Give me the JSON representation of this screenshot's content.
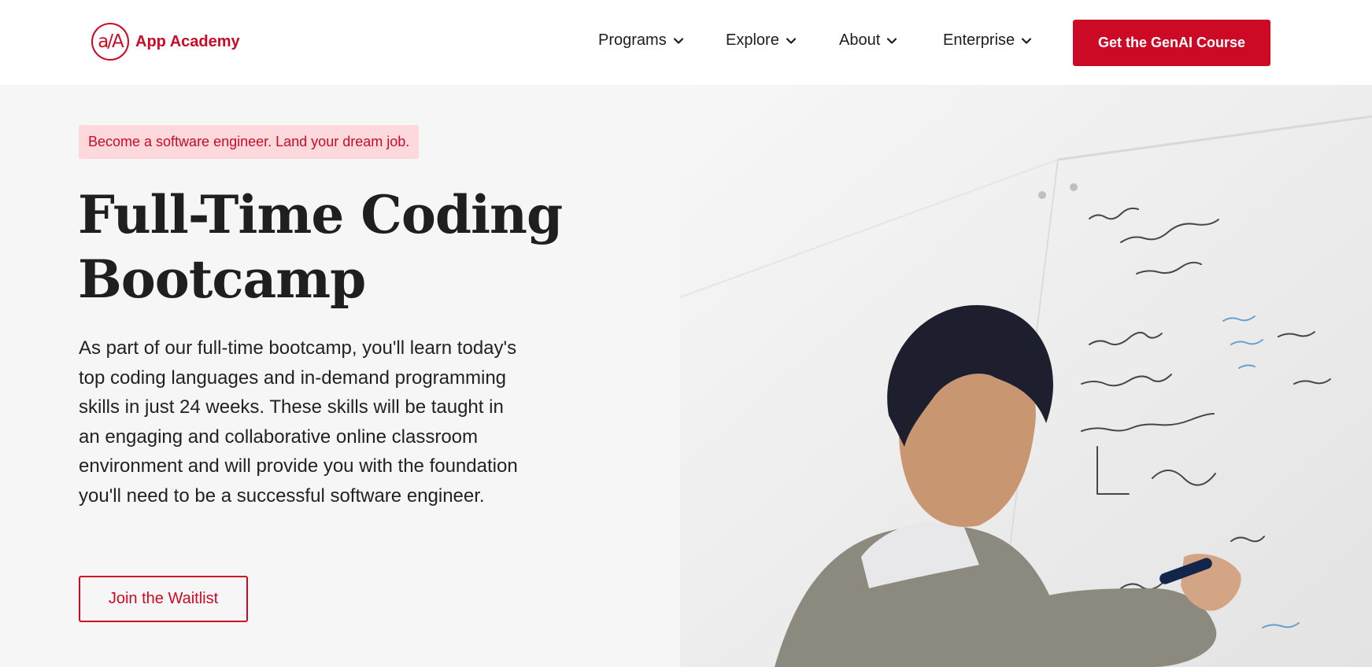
{
  "brand": {
    "logo_mark": "a/A",
    "name": "App Academy",
    "accent_color": "#cc0a25"
  },
  "nav": {
    "items": [
      {
        "label": "Programs",
        "icon": "chevron-down-icon"
      },
      {
        "label": "Explore",
        "icon": "chevron-down-icon"
      },
      {
        "label": "About",
        "icon": "chevron-down-icon"
      },
      {
        "label": "Enterprise",
        "icon": "chevron-down-icon"
      }
    ],
    "cta_label": "Get the GenAI Course"
  },
  "hero": {
    "tagline": "Become a software engineer. Land your dream job.",
    "headline": "Full-Time Coding Bootcamp",
    "body": "As part of our full-time bootcamp, you'll learn today's top coding languages and in-demand programming skills in just 24 weeks. These skills will be taught in an engaging and collaborative online classroom environment and will provide you with the foundation you'll need to be a successful software engineer.",
    "button_label": "Join the Waitlist"
  }
}
